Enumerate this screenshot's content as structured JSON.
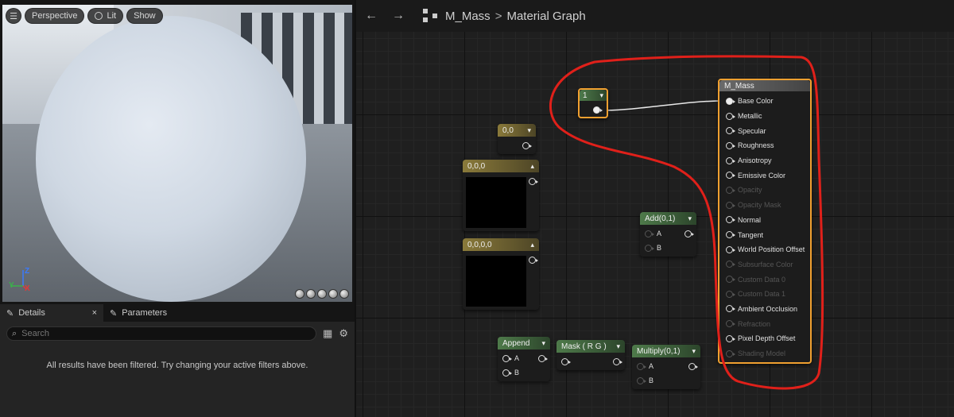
{
  "viewport": {
    "menu_icon": "hamburger-icon",
    "perspective_label": "Perspective",
    "lit_label": "Lit",
    "show_label": "Show",
    "axis_z": "Z",
    "axis_y": "Y",
    "axis_x": "X"
  },
  "details": {
    "tab_details": "Details",
    "tab_details_close": "×",
    "tab_parameters": "Parameters",
    "search_placeholder": "Search",
    "empty_message": "All results have been filtered. Try changing your active filters above."
  },
  "graph": {
    "breadcrumb_asset": "M_Mass",
    "breadcrumb_sep": ">",
    "breadcrumb_graph": "Material Graph"
  },
  "nodes": {
    "const1": {
      "title": "1"
    },
    "const2": {
      "title": "0,0"
    },
    "const3": {
      "title": "0,0,0"
    },
    "const4": {
      "title": "0,0,0,0"
    },
    "add": {
      "title": "Add(0,1)",
      "in_a": "A",
      "in_b": "B"
    },
    "append": {
      "title": "Append",
      "in_a": "A",
      "in_b": "B"
    },
    "mask": {
      "title": "Mask ( R G )"
    },
    "multiply": {
      "title": "Multiply(0,1)",
      "in_a": "A",
      "in_b": "B"
    },
    "material": {
      "title": "M_Mass",
      "pins": [
        {
          "label": "Base Color",
          "enabled": true
        },
        {
          "label": "Metallic",
          "enabled": true
        },
        {
          "label": "Specular",
          "enabled": true
        },
        {
          "label": "Roughness",
          "enabled": true
        },
        {
          "label": "Anisotropy",
          "enabled": true
        },
        {
          "label": "Emissive Color",
          "enabled": true
        },
        {
          "label": "Opacity",
          "enabled": false
        },
        {
          "label": "Opacity Mask",
          "enabled": false
        },
        {
          "label": "Normal",
          "enabled": true
        },
        {
          "label": "Tangent",
          "enabled": true
        },
        {
          "label": "World Position Offset",
          "enabled": true
        },
        {
          "label": "Subsurface Color",
          "enabled": false
        },
        {
          "label": "Custom Data 0",
          "enabled": false
        },
        {
          "label": "Custom Data 1",
          "enabled": false
        },
        {
          "label": "Ambient Occlusion",
          "enabled": true
        },
        {
          "label": "Refraction",
          "enabled": false
        },
        {
          "label": "Pixel Depth Offset",
          "enabled": true
        },
        {
          "label": "Shading Model",
          "enabled": false
        }
      ]
    }
  },
  "colors": {
    "selection": "#f0a030",
    "annotation": "#e0201a",
    "wire": "#e8e8e8"
  }
}
